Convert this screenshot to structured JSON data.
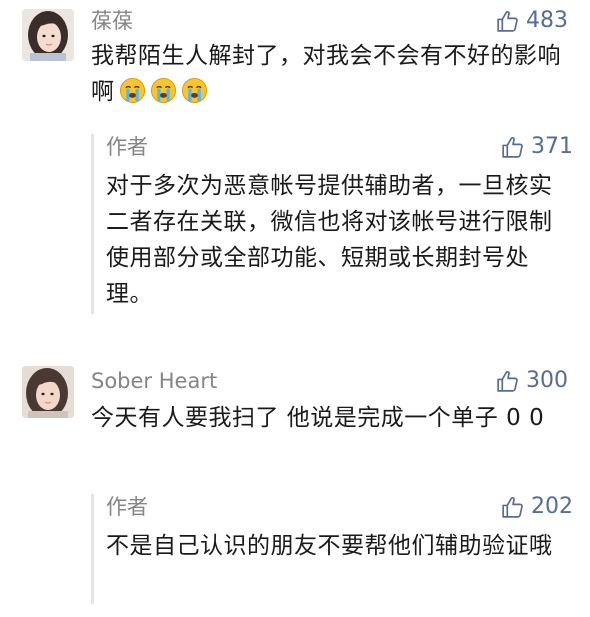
{
  "comments": [
    {
      "author": "葆葆",
      "likes": "483",
      "text": "我帮陌生人解封了，对我会不会有不好的影响啊",
      "emoji": [
        "crying-face-icon",
        "crying-face-icon",
        "crying-face-icon"
      ],
      "reply": {
        "author": "作者",
        "likes": "371",
        "text": "对于多次为恶意帐号提供辅助者，一旦核实二者存在关联，微信也将对该帐号进行限制使用部分或全部功能、短期或长期封号处理。"
      }
    },
    {
      "author": "Sober Heart",
      "likes": "300",
      "text": "今天有人要我扫了 他说是完成一个单子 0 0",
      "reply": {
        "author": "作者",
        "likes": "202",
        "text": "不是自己认识的朋友不要帮他们辅助验证哦"
      }
    }
  ],
  "colors": {
    "accent": "#576b95",
    "meta": "#858585",
    "body": "#1a1a1a",
    "reply_bar": "#e4e4e4"
  }
}
